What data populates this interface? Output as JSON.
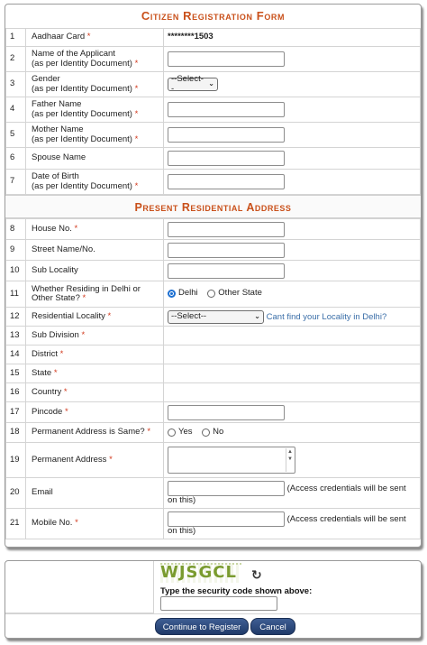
{
  "form": {
    "title": "Citizen Registration Form",
    "section_present": "Present Residential Address",
    "rows": [
      {
        "num": "1",
        "label": "Aadhaar Card",
        "req": "*",
        "value": "********1503"
      },
      {
        "num": "2",
        "label": "Name of the Applicant\n(as per Identity Document)",
        "req": "*"
      },
      {
        "num": "3",
        "label": "Gender\n(as per Identity Document)",
        "req": "*",
        "select": "--Select--"
      },
      {
        "num": "4",
        "label": "Father Name\n(as per Identity Document)",
        "req": "*"
      },
      {
        "num": "5",
        "label": "Mother Name\n(as per Identity Document)",
        "req": "*"
      },
      {
        "num": "6",
        "label": "Spouse Name",
        "req": ""
      },
      {
        "num": "7",
        "label": "Date of Birth\n(as per Identity Document)",
        "req": "*"
      }
    ],
    "address_rows": [
      {
        "num": "8",
        "label": "House No.",
        "req": "*"
      },
      {
        "num": "9",
        "label": "Street Name/No.",
        "req": ""
      },
      {
        "num": "10",
        "label": "Sub Locality",
        "req": ""
      },
      {
        "num": "11",
        "label": "Whether Residing in Delhi or Other State?",
        "req": "*",
        "radio_a": "Delhi",
        "radio_b": "Other State"
      },
      {
        "num": "12",
        "label": "Residential Locality",
        "req": "*",
        "select": "--Select--",
        "link": "Cant find your Locality in Delhi?"
      },
      {
        "num": "13",
        "label": "Sub Division",
        "req": "*"
      },
      {
        "num": "14",
        "label": "District",
        "req": "*"
      },
      {
        "num": "15",
        "label": "State",
        "req": "*"
      },
      {
        "num": "16",
        "label": "Country",
        "req": "*"
      },
      {
        "num": "17",
        "label": "Pincode",
        "req": "*"
      },
      {
        "num": "18",
        "label": "Permanent Address is Same?",
        "req": "*",
        "radio_a": "Yes",
        "radio_b": "No"
      },
      {
        "num": "19",
        "label": "Permanent Address",
        "req": "*"
      },
      {
        "num": "20",
        "label": "Email",
        "req": "",
        "note": "(Access credentials will be sent on this)"
      },
      {
        "num": "21",
        "label": "Mobile No.",
        "req": "*",
        "note": "(Access credentials will be sent on this)"
      }
    ]
  },
  "captcha": {
    "image_text": "WJSGCL",
    "prompt": "Type the security code shown above:",
    "register_button": "Continue to Register",
    "cancel_button": "Cancel"
  },
  "colors": {
    "title": "#c9501a",
    "required": "#d23a1e",
    "link": "#3a6ea8",
    "button": "#2a4677"
  }
}
